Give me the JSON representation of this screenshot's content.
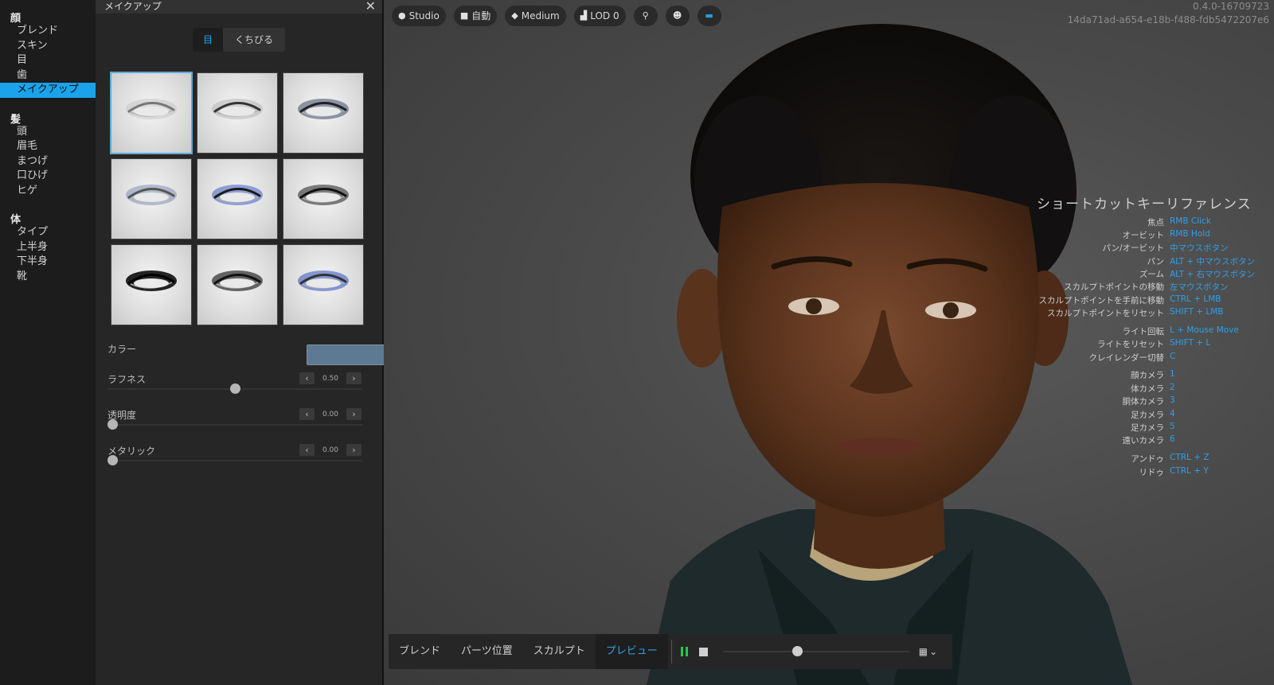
{
  "sidebar": {
    "groups": [
      {
        "title": "顔",
        "items": [
          "ブレンド",
          "スキン",
          "目",
          "歯",
          "メイクアップ"
        ]
      },
      {
        "title": "髪",
        "items": [
          "頭",
          "眉毛",
          "まつげ",
          "口ひげ",
          "ヒゲ"
        ]
      },
      {
        "title": "体",
        "items": [
          "タイプ",
          "上半身",
          "下半身",
          "靴"
        ]
      }
    ],
    "active_item": "メイクアップ"
  },
  "panel": {
    "title": "メイクアップ",
    "tabs": [
      "目",
      "くちびる"
    ],
    "active_tab": "目",
    "presets_count": 9,
    "selected_preset": 1,
    "color_label": "カラー",
    "color_value": "#5d7a92",
    "roughness": {
      "label": "ラフネス",
      "value": "0.50",
      "level": 0.5
    },
    "opacity": {
      "label": "透明度",
      "value": "0.00",
      "level": 0.0
    },
    "metallic": {
      "label": "メタリック",
      "value": "0.00",
      "level": 0.0
    }
  },
  "toolbar": {
    "lighting": "Studio",
    "camera": "自動",
    "quality": "Medium",
    "lod": "LOD 0"
  },
  "version": {
    "build": "0.4.0-16709723",
    "id": "14da71ad-a654-e18b-f488-fdb5472207e6"
  },
  "shortcuts": {
    "title": "ショートカットキーリファレンス",
    "rows": [
      {
        "key": "焦点",
        "value": "RMB Click"
      },
      {
        "key": "オービット",
        "value": "RMB Hold"
      },
      {
        "key": "パン/オービット",
        "value": "中マウスボタン"
      },
      {
        "key": "パン",
        "value": "ALT + 中マウスボタン"
      },
      {
        "key": "ズーム",
        "value": "ALT + 右マウスボタン"
      },
      {
        "key": "スカルプトポイントの移動",
        "value": "左マウスボタン"
      },
      {
        "key": "スカルプトポイントを手前に移動",
        "value": "CTRL + LMB"
      },
      {
        "key": "スカルプトポイントをリセット",
        "value": "SHIFT + LMB"
      },
      {
        "key": "ライト回転",
        "value": "L + Mouse Move"
      },
      {
        "key": "ライトをリセット",
        "value": "SHIFT + L"
      },
      {
        "key": "クレイレンダー切替",
        "value": "C"
      },
      {
        "key": "顔カメラ",
        "value": "1"
      },
      {
        "key": "体カメラ",
        "value": "2"
      },
      {
        "key": "胴体カメラ",
        "value": "3"
      },
      {
        "key": "足カメラ",
        "value": "4"
      },
      {
        "key": "足カメラ",
        "value": "5"
      },
      {
        "key": "遠いカメラ",
        "value": "6"
      },
      {
        "key": "アンドゥ",
        "value": "CTRL + Z"
      },
      {
        "key": "リドゥ",
        "value": "CTRL + Y"
      }
    ]
  },
  "bottombar": {
    "tabs": [
      "ブレンド",
      "パーツ位置",
      "スカルプト",
      "プレビュー"
    ],
    "active_tab": "プレビュー",
    "timeline_position": 0.4
  }
}
